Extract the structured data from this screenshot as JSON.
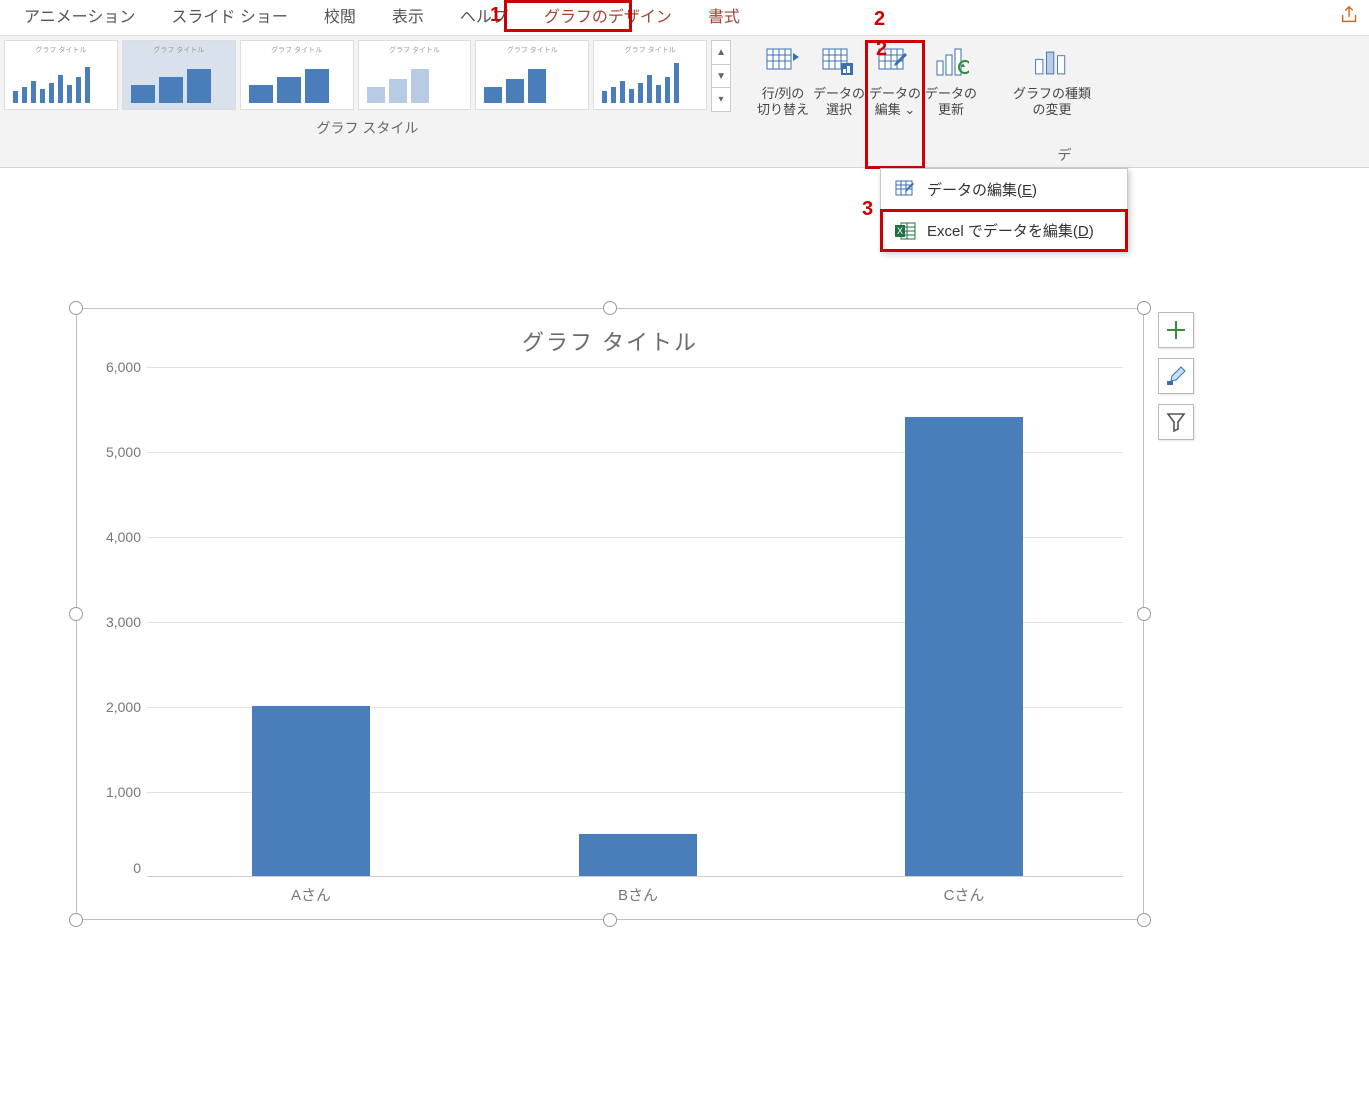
{
  "tabs": {
    "animation": "アニメーション",
    "slideshow": "スライド ショー",
    "review": "校閲",
    "view": "表示",
    "help": "ヘルプ",
    "chartdesign": "グラフのデザイン",
    "format": "書式"
  },
  "callouts": {
    "n1": "1",
    "n2": "2",
    "n3": "3"
  },
  "ribbon": {
    "styles_group": "グラフ スタイル",
    "data_group": "デ",
    "switch_rowcol_l1": "行/列の",
    "switch_rowcol_l2": "切り替え",
    "select_data_l1": "データの",
    "select_data_l2": "選択",
    "edit_data_l1": "データの",
    "edit_data_l2": "編集 ⌄",
    "refresh_data_l1": "データの",
    "refresh_data_l2": "更新",
    "change_type_l1": "グラフの種類",
    "change_type_l2": "の変更"
  },
  "dropdown": {
    "edit_data": "データの編集(",
    "edit_data_key": "E",
    "edit_data_close": ")",
    "edit_excel": "Excel でデータを編集(",
    "edit_excel_key": "D",
    "edit_excel_close": ")"
  },
  "chart": {
    "title": "グラフ タイトル"
  },
  "chart_data": {
    "type": "bar",
    "title": "グラフ タイトル",
    "xlabel": "",
    "ylabel": "",
    "ylim": [
      0,
      6000
    ],
    "yticks": [
      0,
      1000,
      2000,
      3000,
      4000,
      5000,
      6000
    ],
    "ytick_labels": [
      "0",
      "1,000",
      "2,000",
      "3,000",
      "4,000",
      "5,000",
      "6,000"
    ],
    "categories": [
      "Aさん",
      "Bさん",
      "Cさん"
    ],
    "values": [
      2000,
      500,
      5400
    ]
  }
}
